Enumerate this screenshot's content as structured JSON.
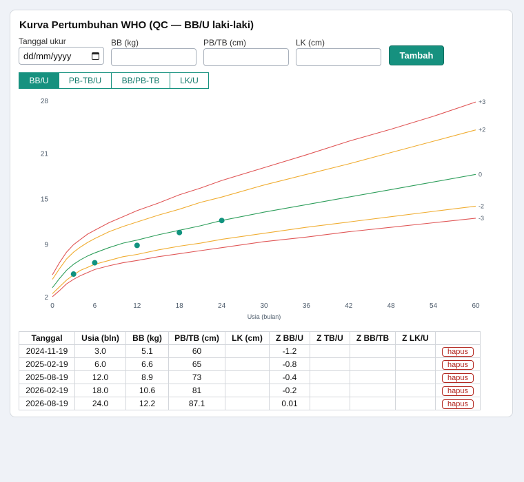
{
  "title": "Kurva Pertumbuhan WHO (QC — BB/U laki-laki)",
  "form": {
    "date_label": "Tanggal ukur",
    "date_placeholder": "dd/mm/yyyy",
    "bb_label": "BB (kg)",
    "pb_label": "PB/TB (cm)",
    "lk_label": "LK (cm)",
    "submit_label": "Tambah"
  },
  "tabs": [
    {
      "label": "BB/U",
      "active": true
    },
    {
      "label": "PB-TB/U",
      "active": false
    },
    {
      "label": "BB/PB-TB",
      "active": false
    },
    {
      "label": "LK/U",
      "active": false
    }
  ],
  "chart_data": {
    "type": "line",
    "title": "",
    "xlabel": "Usia (bulan)",
    "ylabel": "",
    "xlim": [
      0,
      60
    ],
    "ylim": [
      2,
      28
    ],
    "xticks": [
      0,
      6,
      12,
      18,
      24,
      30,
      36,
      42,
      48,
      54,
      60
    ],
    "yticks": [
      2,
      9,
      15,
      21,
      28
    ],
    "grid": false,
    "colors": {
      "sd3": "#e05757",
      "sd2": "#f0ad32",
      "median": "#2e9e5b",
      "points": "#11937f"
    },
    "series": [
      {
        "name": "+3",
        "x": [
          0,
          1,
          2,
          3,
          4,
          5,
          6,
          8,
          10,
          12,
          15,
          18,
          21,
          24,
          30,
          36,
          42,
          48,
          54,
          60
        ],
        "values": [
          5.0,
          6.6,
          8.0,
          9.0,
          9.7,
          10.4,
          10.9,
          11.9,
          12.7,
          13.5,
          14.5,
          15.6,
          16.5,
          17.5,
          19.2,
          20.9,
          22.7,
          24.3,
          26.0,
          27.9
        ]
      },
      {
        "name": "+2",
        "x": [
          0,
          1,
          2,
          3,
          4,
          5,
          6,
          8,
          10,
          12,
          15,
          18,
          21,
          24,
          30,
          36,
          42,
          48,
          54,
          60
        ],
        "values": [
          4.4,
          5.8,
          7.1,
          8.0,
          8.7,
          9.3,
          9.8,
          10.7,
          11.4,
          12.0,
          12.9,
          13.7,
          14.6,
          15.3,
          16.9,
          18.3,
          19.7,
          21.2,
          22.7,
          24.2
        ]
      },
      {
        "name": "0",
        "x": [
          0,
          1,
          2,
          3,
          4,
          5,
          6,
          8,
          10,
          12,
          15,
          18,
          21,
          24,
          30,
          36,
          42,
          48,
          54,
          60
        ],
        "values": [
          3.3,
          4.5,
          5.6,
          6.4,
          7.0,
          7.5,
          7.9,
          8.6,
          9.2,
          9.6,
          10.3,
          10.9,
          11.5,
          12.2,
          13.3,
          14.3,
          15.3,
          16.3,
          17.3,
          18.3
        ]
      },
      {
        "name": "-2",
        "x": [
          0,
          1,
          2,
          3,
          4,
          5,
          6,
          8,
          10,
          12,
          15,
          18,
          21,
          24,
          30,
          36,
          42,
          48,
          54,
          60
        ],
        "values": [
          2.5,
          3.4,
          4.3,
          5.0,
          5.6,
          6.0,
          6.4,
          6.9,
          7.4,
          7.7,
          8.3,
          8.8,
          9.2,
          9.7,
          10.5,
          11.3,
          12.0,
          12.7,
          13.4,
          14.1
        ]
      },
      {
        "name": "-3",
        "x": [
          0,
          1,
          2,
          3,
          4,
          5,
          6,
          8,
          10,
          12,
          15,
          18,
          21,
          24,
          30,
          36,
          42,
          48,
          54,
          60
        ],
        "values": [
          2.1,
          2.9,
          3.8,
          4.4,
          4.9,
          5.3,
          5.7,
          6.2,
          6.6,
          6.9,
          7.4,
          7.8,
          8.2,
          8.6,
          9.4,
          10.0,
          10.7,
          11.3,
          11.9,
          12.5
        ]
      }
    ],
    "points": {
      "x": [
        3.0,
        6.0,
        12.0,
        18.0,
        24.0
      ],
      "values": [
        5.1,
        6.6,
        8.9,
        10.6,
        12.2
      ]
    }
  },
  "table": {
    "headers": [
      "Tanggal",
      "Usia (bln)",
      "BB (kg)",
      "PB/TB (cm)",
      "LK (cm)",
      "Z BB/U",
      "Z TB/U",
      "Z BB/TB",
      "Z LK/U",
      ""
    ],
    "delete_label": "hapus",
    "rows": [
      [
        "2024-11-19",
        "3.0",
        "5.1",
        "60",
        "",
        "-1.2",
        "",
        "",
        ""
      ],
      [
        "2025-02-19",
        "6.0",
        "6.6",
        "65",
        "",
        "-0.8",
        "",
        "",
        ""
      ],
      [
        "2025-08-19",
        "12.0",
        "8.9",
        "73",
        "",
        "-0.4",
        "",
        "",
        ""
      ],
      [
        "2026-02-19",
        "18.0",
        "10.6",
        "81",
        "",
        "-0.2",
        "",
        "",
        ""
      ],
      [
        "2026-08-19",
        "24.0",
        "12.2",
        "87.1",
        "",
        "0.01",
        "",
        "",
        ""
      ]
    ]
  }
}
